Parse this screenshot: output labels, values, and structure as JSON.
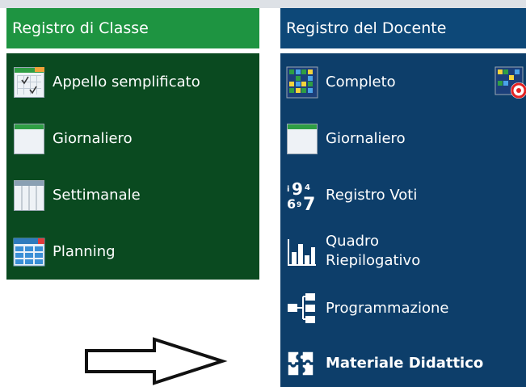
{
  "classe": {
    "title": "Registro di Classe",
    "items": [
      {
        "label": "Appello semplificato",
        "icon": "checklist-sheet-icon"
      },
      {
        "label": "Giornaliero",
        "icon": "daily-sheet-icon"
      },
      {
        "label": "Settimanale",
        "icon": "weekly-sheet-icon"
      },
      {
        "label": "Planning",
        "icon": "planning-table-icon"
      }
    ]
  },
  "docente": {
    "title": "Registro del Docente",
    "items": [
      {
        "label": "Completo",
        "icon": "color-grid-icon"
      },
      {
        "label": "Giornaliero",
        "icon": "daily-sheet-icon"
      },
      {
        "label": "Registro Voti",
        "icon": "numbers-icon"
      },
      {
        "label_line1": "Quadro",
        "label_line2": "Riepilogativo",
        "icon": "bar-chart-icon"
      },
      {
        "label": "Programmazione",
        "icon": "flowchart-icon"
      },
      {
        "label": "Materiale Didattico",
        "icon": "puzzle-icon"
      }
    ],
    "extra_icon": "grid-target-icon"
  },
  "colors": {
    "classe_header": "#1e9441",
    "classe_body": "#0a4a20",
    "docente_header": "#0d4878",
    "docente_body": "#0d3e6a"
  },
  "annotation": {
    "icon": "right-arrow-icon"
  }
}
